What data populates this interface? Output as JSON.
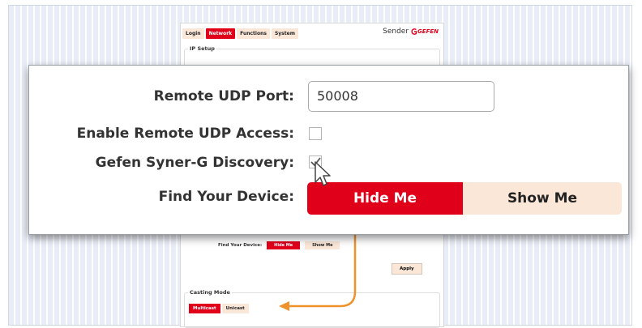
{
  "tabs": [
    {
      "label": "Login"
    },
    {
      "label": "Network",
      "active": true
    },
    {
      "label": "Functions"
    },
    {
      "label": "System"
    }
  ],
  "header": {
    "device": "Sender",
    "brand": "GEFEN"
  },
  "ip_setup": {
    "legend": "IP Setup"
  },
  "mini": {
    "discovery_label": "Gefen Syner-G Discovery:",
    "find_label": "Find Your Device:",
    "hide_label": "Hide Me",
    "show_label": "Show Me",
    "apply_label": "Apply"
  },
  "casting": {
    "legend": "Casting Mode",
    "multicast_label": "Multicast",
    "unicast_label": "Unicast",
    "selected": "Multicast"
  },
  "zoom": {
    "remote_udp_port_label": "Remote UDP Port:",
    "remote_udp_port_value": "50008",
    "enable_remote_udp_label": "Enable Remote UDP Access:",
    "enable_remote_udp_checked": false,
    "syner_g_label": "Gefen Syner-G Discovery:",
    "syner_g_checked": true,
    "find_device_label": "Find Your Device:",
    "hide_me_label": "Hide Me",
    "show_me_label": "Show Me"
  },
  "colors": {
    "accent": "#e0001a",
    "button_light": "#fbe7d8",
    "arrow": "#f0922b",
    "background_stripes": "#e9edf7"
  }
}
